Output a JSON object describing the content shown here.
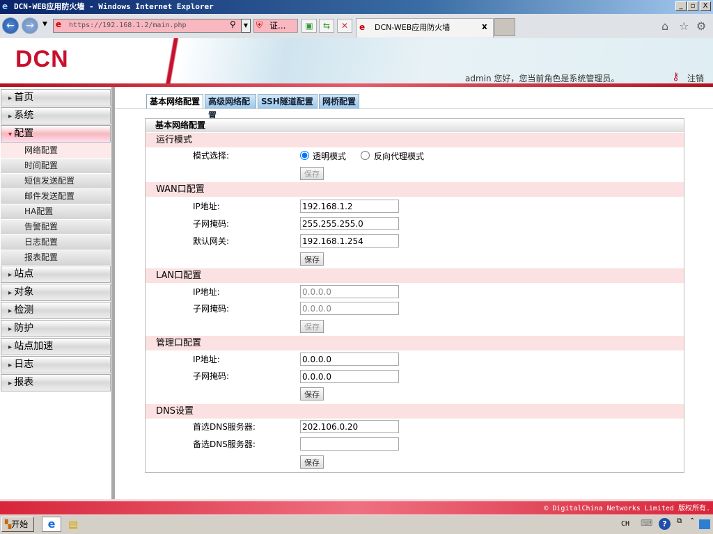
{
  "window": {
    "title": "DCN-WEB应用防火墙 - Windows Internet Explorer",
    "min": "_",
    "max": "▫",
    "close": "X"
  },
  "browser": {
    "url": "https://192.168.1.2/main.php",
    "cert": "证...",
    "tab_title": "DCN-WEB应用防火墙",
    "tab_close": "x"
  },
  "header": {
    "logo": "DCN",
    "greeting": "admin 您好，您当前角色是系统管理员。",
    "logout": "注销"
  },
  "sidebar": {
    "top": [
      {
        "label": "首页"
      },
      {
        "label": "系统"
      },
      {
        "label": "配置",
        "active": true
      }
    ],
    "sub": [
      {
        "label": "网络配置",
        "active": true
      },
      {
        "label": "时间配置"
      },
      {
        "label": "短信发送配置"
      },
      {
        "label": "邮件发送配置"
      },
      {
        "label": "HA配置"
      },
      {
        "label": "告警配置"
      },
      {
        "label": "日志配置"
      },
      {
        "label": "报表配置"
      }
    ],
    "bottom": [
      {
        "label": "站点"
      },
      {
        "label": "对象"
      },
      {
        "label": "检测"
      },
      {
        "label": "防护"
      },
      {
        "label": "站点加速"
      },
      {
        "label": "日志"
      },
      {
        "label": "报表"
      }
    ]
  },
  "tabs": [
    {
      "label": "基本网络配置",
      "active": true
    },
    {
      "label": "高级网络配置"
    },
    {
      "label": "SSH隧道配置"
    },
    {
      "label": "网桥配置"
    }
  ],
  "panel": {
    "title": "基本网络配置",
    "mode": {
      "title": "运行模式",
      "label": "模式选择:",
      "opt1": "透明模式",
      "opt2": "反向代理模式",
      "selected": "透明模式",
      "save": "保存"
    },
    "wan": {
      "title": "WAN口配置",
      "ip_label": "IP地址:",
      "ip": "192.168.1.2",
      "mask_label": "子网掩码:",
      "mask": "255.255.255.0",
      "gw_label": "默认网关:",
      "gw": "192.168.1.254",
      "save": "保存"
    },
    "lan": {
      "title": "LAN口配置",
      "ip_label": "IP地址:",
      "ip": "0.0.0.0",
      "mask_label": "子网掩码:",
      "mask": "0.0.0.0",
      "save": "保存"
    },
    "mgmt": {
      "title": "管理口配置",
      "ip_label": "IP地址:",
      "ip": "0.0.0.0",
      "mask_label": "子网掩码:",
      "mask": "0.0.0.0",
      "save": "保存"
    },
    "dns": {
      "title": "DNS设置",
      "dns1_label": "首选DNS服务器:",
      "dns1": "202.106.0.20",
      "dns2_label": "备选DNS服务器:",
      "dns2": "",
      "save": "保存"
    }
  },
  "footer": {
    "copyright": "© DigitalChina Networks Limited 版权所有."
  },
  "taskbar": {
    "start": "开始",
    "lang": "CH"
  }
}
